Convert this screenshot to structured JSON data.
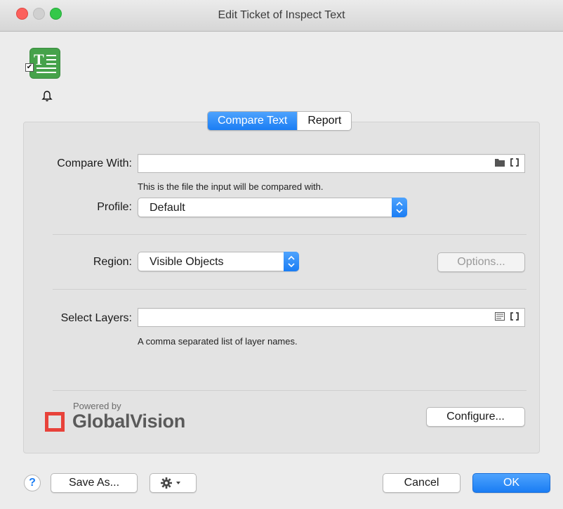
{
  "window": {
    "title": "Edit Ticket of Inspect Text"
  },
  "header": {
    "app_icon_name": "inspect-text-icon",
    "bell_icon_name": "bell-icon",
    "app_icon_letter": "T",
    "checkbox_mark": "✔"
  },
  "tabs": [
    {
      "label": "Compare Text",
      "active": true
    },
    {
      "label": "Report",
      "active": false
    }
  ],
  "form": {
    "compare_with": {
      "label": "Compare With:",
      "value": "",
      "hint": "This is the file the input will be compared with.",
      "icons": [
        "folder-icon",
        "brackets-icon"
      ]
    },
    "profile": {
      "label": "Profile:",
      "value": "Default"
    },
    "region": {
      "label": "Region:",
      "value": "Visible Objects",
      "options_button": "Options...",
      "options_enabled": false
    },
    "select_layers": {
      "label": "Select Layers:",
      "value": "",
      "hint": "A comma separated list of layer names.",
      "icons": [
        "list-icon",
        "brackets-icon"
      ]
    }
  },
  "branding": {
    "powered_by": "Powered by",
    "name": "GlobalVision",
    "configure_button": "Configure..."
  },
  "footer": {
    "help_label": "?",
    "save_as_label": "Save As...",
    "gear_menu_icon": "gear-icon",
    "cancel_label": "Cancel",
    "ok_label": "OK"
  },
  "colors": {
    "accent": "#1a7df4",
    "logo_red": "#e8423a",
    "app_icon_green": "#45a24a"
  }
}
